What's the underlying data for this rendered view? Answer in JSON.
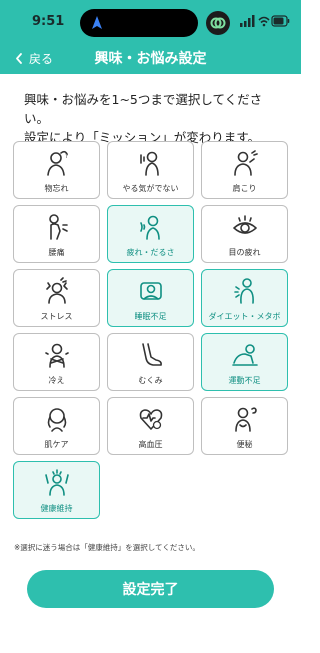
{
  "status_bar": {
    "time": "9:51"
  },
  "nav": {
    "back_label": "戻る",
    "title": "興味・お悩み設定"
  },
  "instructions": {
    "line1": "興味・お悩みを1~5つまで選択してください。",
    "line2": "設定により「ミッション」が変わります。"
  },
  "options": [
    {
      "label": "物忘れ",
      "selected": false,
      "icon": "forgetful-icon"
    },
    {
      "label": "やる気がでない",
      "selected": false,
      "icon": "unmotivated-icon"
    },
    {
      "label": "肩こり",
      "selected": false,
      "icon": "stiff-shoulder-icon"
    },
    {
      "label": "腰痛",
      "selected": false,
      "icon": "back-pain-icon"
    },
    {
      "label": "疲れ・だるさ",
      "selected": true,
      "icon": "fatigue-icon"
    },
    {
      "label": "目の疲れ",
      "selected": false,
      "icon": "eye-strain-icon"
    },
    {
      "label": "ストレス",
      "selected": false,
      "icon": "stress-icon"
    },
    {
      "label": "睡眠不足",
      "selected": true,
      "icon": "sleep-icon"
    },
    {
      "label": "ダイエット・メタボ",
      "selected": true,
      "icon": "diet-icon"
    },
    {
      "label": "冷え",
      "selected": false,
      "icon": "cold-icon"
    },
    {
      "label": "むくみ",
      "selected": false,
      "icon": "swelling-icon"
    },
    {
      "label": "運動不足",
      "selected": true,
      "icon": "exercise-icon"
    },
    {
      "label": "肌ケア",
      "selected": false,
      "icon": "skin-care-icon"
    },
    {
      "label": "高血圧",
      "selected": false,
      "icon": "blood-pressure-icon"
    },
    {
      "label": "便秘",
      "selected": false,
      "icon": "constipation-icon"
    },
    {
      "label": "健康維持",
      "selected": true,
      "icon": "health-icon"
    }
  ],
  "note": "※選択に迷う場合は「健康維持」を選択してください。",
  "submit_label": "設定完了",
  "colors": {
    "accent": "#2ebfae",
    "selected_bg": "#e9f8f5",
    "selected_text": "#0f8f82"
  }
}
